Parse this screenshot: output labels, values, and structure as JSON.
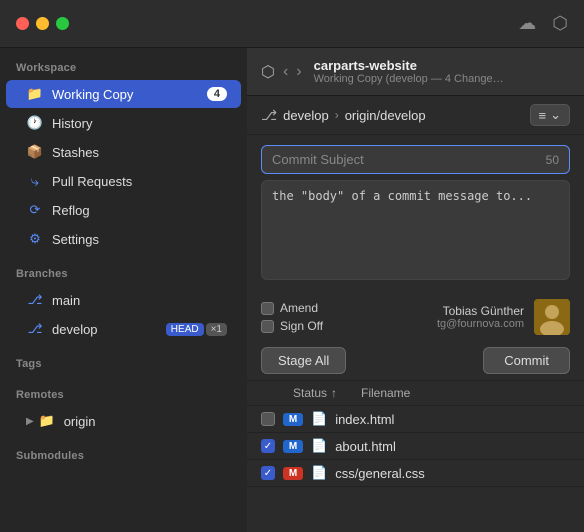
{
  "titlebar": {
    "traffic_lights": [
      "red",
      "yellow",
      "green"
    ],
    "icon_cloud": "☁",
    "icon_box": "⬡"
  },
  "sidebar": {
    "workspace_label": "Workspace",
    "items": [
      {
        "id": "working-copy",
        "label": "Working Copy",
        "icon": "📁",
        "icon_color": "blue",
        "badge": "4",
        "active": true
      },
      {
        "id": "history",
        "label": "History",
        "icon": "🕐",
        "icon_color": "blue",
        "active": false
      },
      {
        "id": "stashes",
        "label": "Stashes",
        "icon": "📦",
        "icon_color": "blue",
        "active": false
      },
      {
        "id": "pull-requests",
        "label": "Pull Requests",
        "icon": "⤷",
        "icon_color": "blue",
        "active": false
      },
      {
        "id": "reflog",
        "label": "Reflog",
        "icon": "⟳",
        "icon_color": "blue",
        "active": false
      },
      {
        "id": "settings",
        "label": "Settings",
        "icon": "⚙",
        "icon_color": "blue",
        "active": false
      }
    ],
    "branches_label": "Branches",
    "branches": [
      {
        "id": "main",
        "label": "main",
        "tags": []
      },
      {
        "id": "develop",
        "label": "develop",
        "tags": [
          "HEAD",
          "×1"
        ]
      }
    ],
    "tags_label": "Tags",
    "remotes_label": "Remotes",
    "remotes": [
      {
        "id": "origin",
        "label": "origin",
        "expanded": false
      }
    ],
    "submodules_label": "Submodules"
  },
  "repo_header": {
    "icon": "⬡",
    "nav_back": "‹",
    "nav_forward": "›",
    "repo_name": "carparts-website",
    "repo_subtitle": "Working Copy (develop — 4 Change…"
  },
  "branch_bar": {
    "icon": "⎇",
    "branch_name": "develop",
    "arrow": "›",
    "remote": "origin/develop",
    "list_icon": "≡",
    "chevron": "⌄"
  },
  "commit_form": {
    "subject_placeholder": "Commit Subject",
    "subject_counter": "50",
    "body_text": "the \"body\" of a commit message to...",
    "amend_label": "Amend",
    "sign_off_label": "Sign Off",
    "author_name": "Tobias Günther",
    "author_email": "tg@fournova.com",
    "avatar_emoji": "👤"
  },
  "buttons": {
    "stage_all": "Stage All",
    "commit": "Commit"
  },
  "file_table": {
    "header_status": "Status",
    "header_filename": "Filename",
    "files": [
      {
        "id": "index-html",
        "checked": false,
        "status": "M",
        "status_color": "blue",
        "name": "index.html",
        "file_icon": "📄"
      },
      {
        "id": "about-html",
        "checked": true,
        "status": "M",
        "status_color": "blue",
        "name": "about.html",
        "file_icon": "📄"
      },
      {
        "id": "css-general",
        "checked": true,
        "status": "M",
        "status_color": "orange",
        "name": "css/general.css",
        "file_icon": "📄"
      }
    ]
  }
}
